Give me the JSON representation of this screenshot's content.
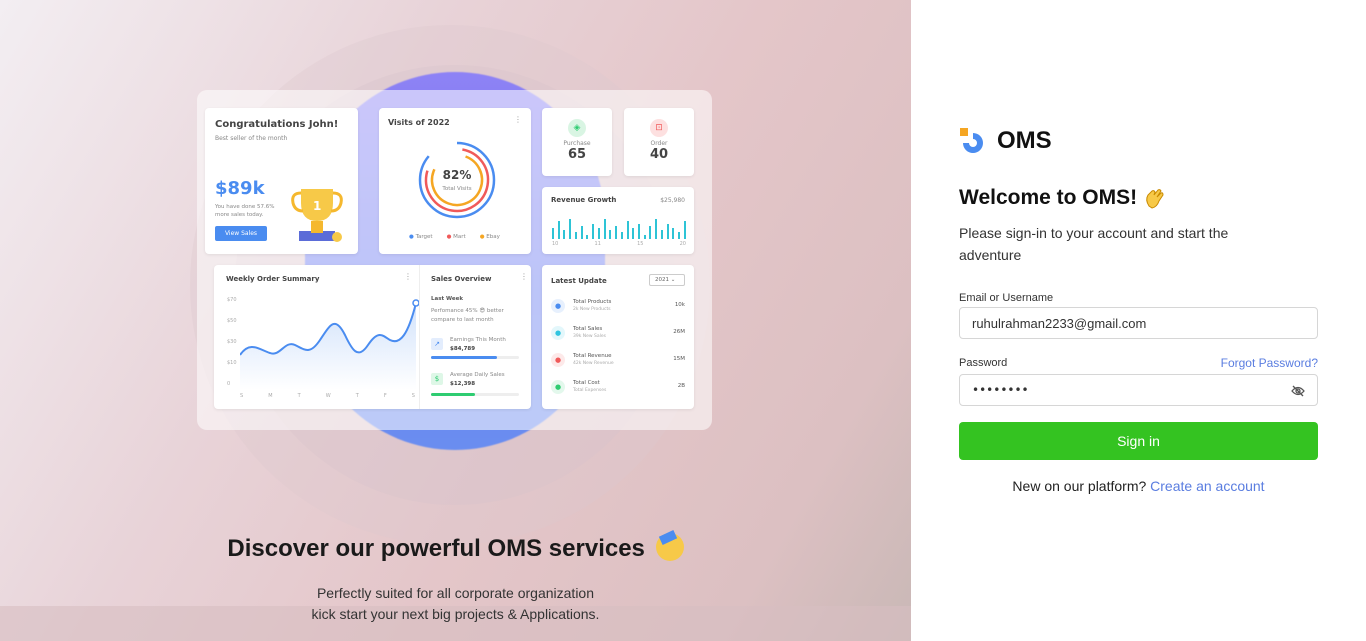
{
  "hero": {
    "title": "Discover our powerful OMS services",
    "subtitle_line1": "Perfectly suited for all corporate organization",
    "subtitle_line2": "kick start your next big projects & Applications.",
    "emoji_icon": "party-face-icon"
  },
  "dashboard": {
    "congrats": {
      "title": "Congratulations John!",
      "sub": "Best seller of the month",
      "amount": "$89k",
      "note1": "You have done 57.6%",
      "note2": "more sales today.",
      "button": "View Sales"
    },
    "visits": {
      "title": "Visits of 2022",
      "value": "82%",
      "caption": "Total Visits",
      "legend": [
        "Target",
        "Mart",
        "Ebay"
      ],
      "legend_colors": [
        "#4a8cf0",
        "#f05a5a",
        "#f5a623"
      ]
    },
    "purchase": {
      "label": "Purchase",
      "value": "65"
    },
    "order": {
      "label": "Order",
      "value": "40"
    },
    "revenue": {
      "title": "Revenue Growth",
      "value": "$25,980",
      "ticks": [
        "10",
        "11",
        "15",
        "20"
      ],
      "bars": [
        0.5,
        0.8,
        0.4,
        0.9,
        0.3,
        0.6,
        0.2,
        0.7,
        0.5,
        0.9,
        0.4,
        0.6,
        0.3,
        0.8,
        0.5,
        0.7,
        0.2,
        0.6,
        0.9,
        0.4,
        0.7,
        0.5,
        0.3,
        0.8
      ]
    },
    "weekly": {
      "title": "Weekly Order Summary",
      "y_ticks": [
        "$70",
        "$50",
        "$30",
        "$10",
        "0"
      ],
      "x_ticks": [
        "S",
        "M",
        "T",
        "W",
        "T",
        "F",
        "S"
      ]
    },
    "sales_overview": {
      "title": "Sales Overview",
      "period": "Last Week",
      "text1": "Perfomance 45% 😎 better",
      "text2": "compare to last month",
      "items": [
        {
          "label": "Earnings This Month",
          "value": "$84,789",
          "color": "#4a8cf0",
          "fill": 0.75
        },
        {
          "label": "Average Daily Sales",
          "value": "$12,398",
          "color": "#2ecc71",
          "fill": 0.5
        }
      ]
    },
    "latest": {
      "title": "Latest Update",
      "year": "2021",
      "items": [
        {
          "title": "Total Products",
          "sub": "2k New Products",
          "value": "10k",
          "color": "#4a8cf0",
          "icon": "box-icon"
        },
        {
          "title": "Total Sales",
          "sub": "39k New Sales",
          "value": "26M",
          "color": "#2ec4e0",
          "icon": "pie-chart-icon"
        },
        {
          "title": "Total Revenue",
          "sub": "42k New Revenue",
          "value": "15M",
          "color": "#f05a5a",
          "icon": "card-icon"
        },
        {
          "title": "Total Cost",
          "sub": "Total Expenses",
          "value": "2B",
          "color": "#2ecc71",
          "icon": "dollar-icon"
        }
      ]
    }
  },
  "brand": {
    "name": "OMS",
    "logo_icon": "oms-logo-icon"
  },
  "login": {
    "welcome": "Welcome to OMS!",
    "wave_icon": "waving-hand-icon",
    "intro": "Please sign-in to your account and start the adventure",
    "email_label": "Email or Username",
    "email_value": "ruhulrahman2233@gmail.com",
    "password_label": "Password",
    "forgot": "Forgot Password?",
    "password_mask": "••••••••",
    "eye_icon": "eye-off-icon",
    "signin": "Sign in",
    "new_text": "New on our platform?",
    "create": "Create an account"
  },
  "colors": {
    "accent": "#6c7cf0",
    "green": "#34c321",
    "link": "#5a7de0"
  }
}
